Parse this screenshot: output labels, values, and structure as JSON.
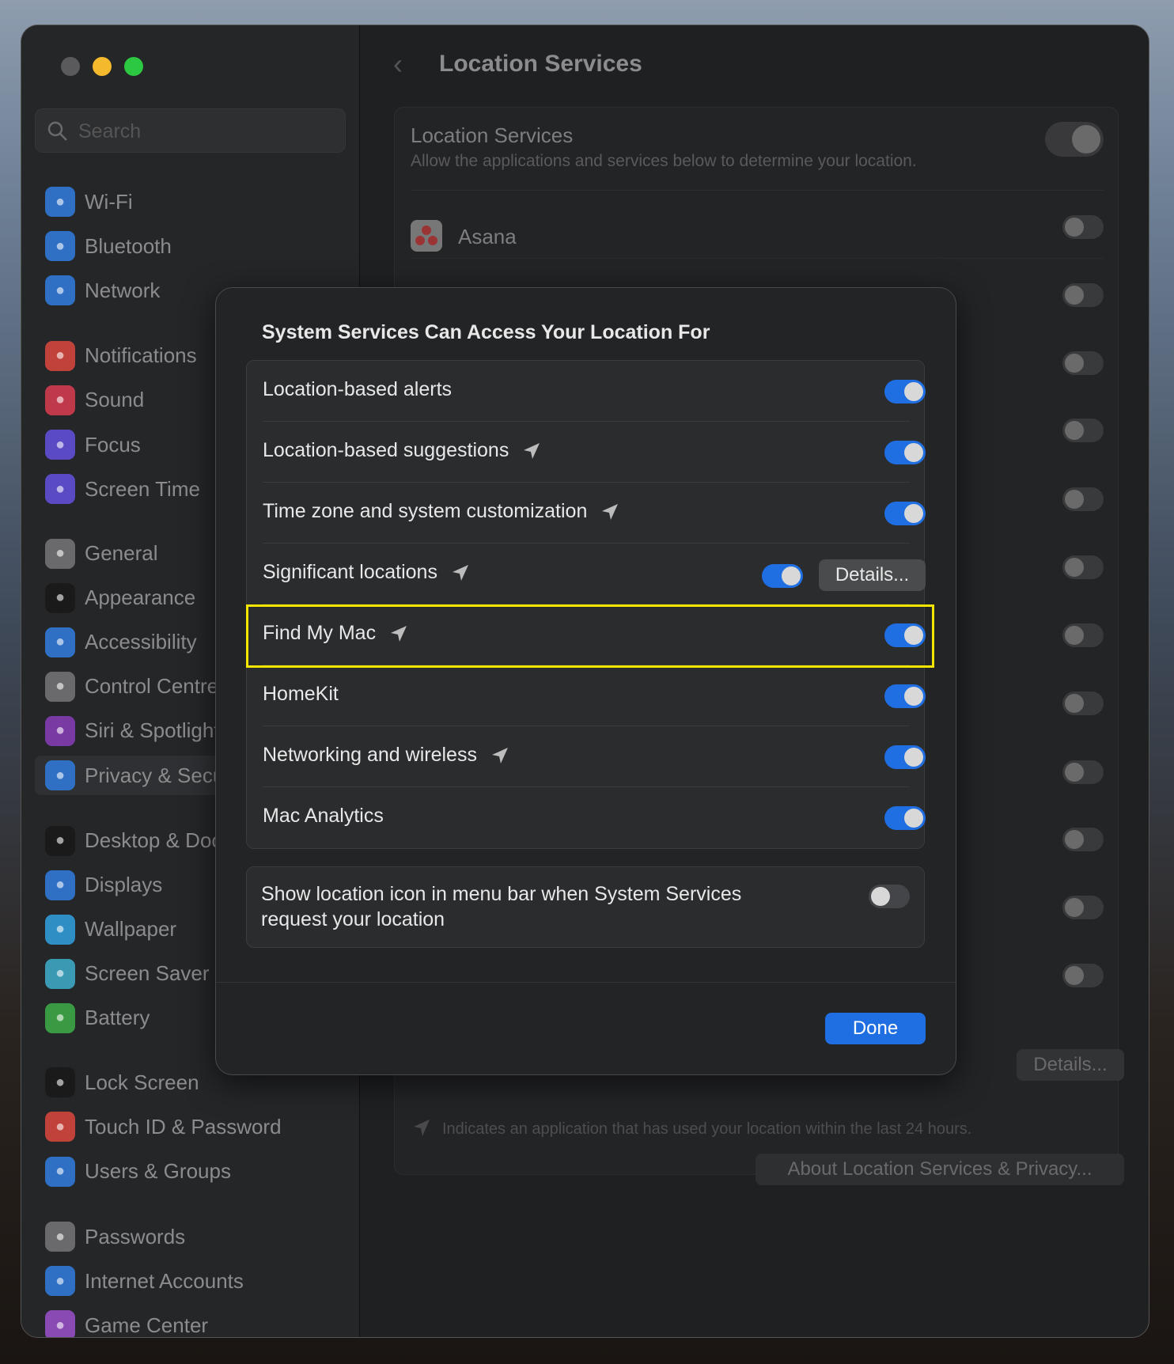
{
  "sidebar": {
    "search_placeholder": "Search",
    "items": [
      {
        "label": "Wi-Fi",
        "icon": "wifi-icon",
        "color": "#2f6fc4"
      },
      {
        "label": "Bluetooth",
        "icon": "bluetooth-icon",
        "color": "#2f6fc4"
      },
      {
        "label": "Network",
        "icon": "globe-icon",
        "color": "#2f6fc4"
      },
      {
        "label": "Notifications",
        "icon": "bell-icon",
        "color": "#c0423a"
      },
      {
        "label": "Sound",
        "icon": "speaker-icon",
        "color": "#c0394a"
      },
      {
        "label": "Focus",
        "icon": "moon-icon",
        "color": "#5a4bc4"
      },
      {
        "label": "Screen Time",
        "icon": "hourglass-icon",
        "color": "#5a4bc4"
      },
      {
        "label": "General",
        "icon": "gear-icon",
        "color": "#6a6a6c"
      },
      {
        "label": "Appearance",
        "icon": "appearance-icon",
        "color": "#1a1a1a"
      },
      {
        "label": "Accessibility",
        "icon": "accessibility-icon",
        "color": "#2f6fc4"
      },
      {
        "label": "Control Centre",
        "icon": "control-centre-icon",
        "color": "#6a6a6c"
      },
      {
        "label": "Siri & Spotlight",
        "icon": "siri-icon",
        "color": "#7a3aa4"
      },
      {
        "label": "Privacy & Security",
        "icon": "hand-icon",
        "color": "#2f6fc4",
        "selected": true
      },
      {
        "label": "Desktop & Dock",
        "icon": "dock-icon",
        "color": "#1a1a1a"
      },
      {
        "label": "Displays",
        "icon": "sun-icon",
        "color": "#2f6fc4"
      },
      {
        "label": "Wallpaper",
        "icon": "flower-icon",
        "color": "#2f8fc4"
      },
      {
        "label": "Screen Saver",
        "icon": "screensaver-icon",
        "color": "#3a9ab4"
      },
      {
        "label": "Battery",
        "icon": "battery-icon",
        "color": "#3a9a44"
      },
      {
        "label": "Lock Screen",
        "icon": "lock-icon",
        "color": "#1a1a1a"
      },
      {
        "label": "Touch ID & Password",
        "icon": "fingerprint-icon",
        "color": "#c0423a"
      },
      {
        "label": "Users & Groups",
        "icon": "users-icon",
        "color": "#2f6fc4"
      },
      {
        "label": "Passwords",
        "icon": "key-icon",
        "color": "#6a6a6c"
      },
      {
        "label": "Internet Accounts",
        "icon": "at-icon",
        "color": "#2f6fc4"
      },
      {
        "label": "Game Center",
        "icon": "game-center-icon",
        "color": "#8a4ab4"
      }
    ]
  },
  "header": {
    "title": "Location Services"
  },
  "panel": {
    "title": "Location Services",
    "description": "Allow the applications and services below to determine your location.",
    "master_toggle": true,
    "apps": [
      {
        "name": "Asana",
        "on": false
      }
    ],
    "details_label": "Details...",
    "footnote": "Indicates an application that has used your location within the last 24 hours.",
    "about_label": "About Location Services & Privacy..."
  },
  "dialog": {
    "title": "System Services Can Access Your Location For",
    "rows": [
      {
        "label": "Location-based alerts",
        "arrow": false,
        "on": true
      },
      {
        "label": "Location-based suggestions",
        "arrow": true,
        "on": true
      },
      {
        "label": "Time zone and system customization",
        "arrow": true,
        "on": true
      },
      {
        "label": "Significant locations",
        "arrow": true,
        "on": true,
        "details": "Details..."
      },
      {
        "label": "Find My Mac",
        "arrow": true,
        "on": true,
        "highlighted": true
      },
      {
        "label": "HomeKit",
        "arrow": false,
        "on": true
      },
      {
        "label": "Networking and wireless",
        "arrow": true,
        "on": true
      },
      {
        "label": "Mac Analytics",
        "arrow": false,
        "on": true
      }
    ],
    "menu_bar_option": {
      "label": "Show location icon in menu bar when System Services request your location",
      "on": false
    },
    "done_label": "Done"
  },
  "colors": {
    "accent": "#1f6fe3",
    "highlight": "#f5e600"
  }
}
